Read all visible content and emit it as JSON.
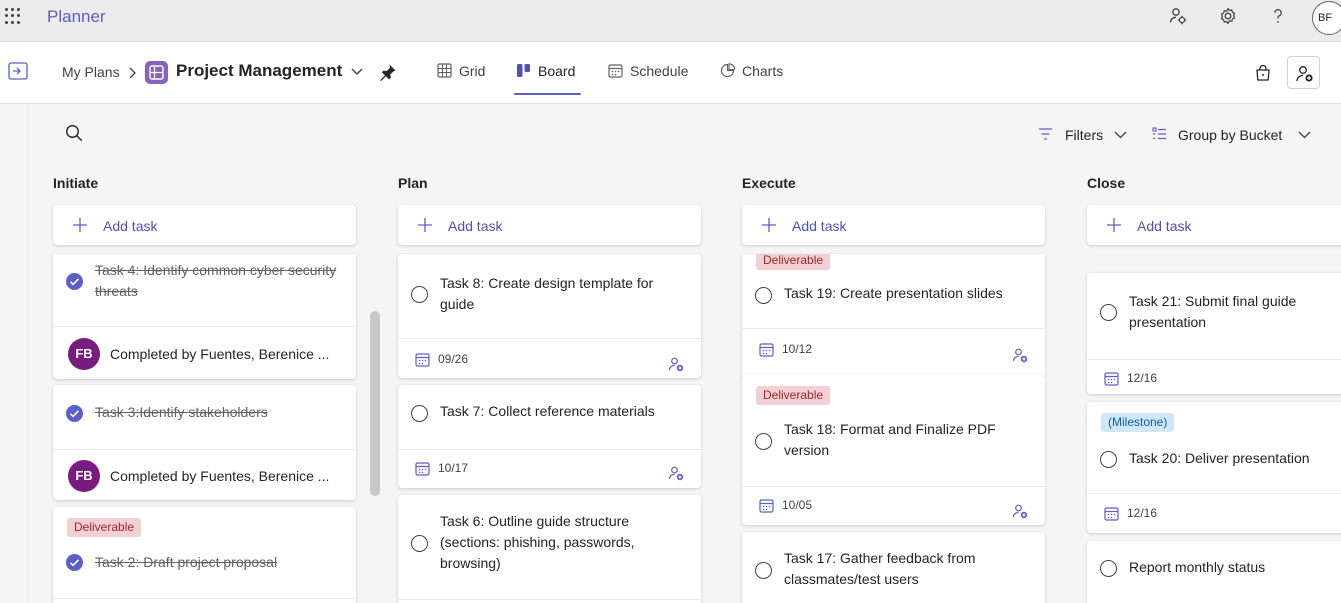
{
  "app": {
    "name": "Planner",
    "user_initials": "BF"
  },
  "header": {
    "breadcrumb_root": "My Plans",
    "plan_title": "Project Management",
    "tabs": [
      {
        "label": "Grid",
        "icon": "grid-icon",
        "active": false
      },
      {
        "label": "Board",
        "icon": "board-icon",
        "active": true
      },
      {
        "label": "Schedule",
        "icon": "calendar-icon",
        "active": false
      },
      {
        "label": "Charts",
        "icon": "chart-icon",
        "active": false
      }
    ]
  },
  "toolbar": {
    "filters_label": "Filters",
    "group_by_label": "Group by Bucket"
  },
  "colors": {
    "accent": "#5b5fc7",
    "deliverable_bg": "#f1d0d3",
    "milestone_bg": "#d0e7f8",
    "avatar": "#7a1c7f"
  },
  "buckets": [
    {
      "name": "Initiate",
      "add_task_label": "Add task",
      "tasks": [
        {
          "title": "Task 4: Identify common cyber security threats",
          "completed": true,
          "avatar": "FB",
          "completed_by": "Completed by Fuentes, Berenice ..."
        },
        {
          "title": "Task 3:Identify stakeholders",
          "completed": true,
          "avatar": "FB",
          "completed_by": "Completed by Fuentes, Berenice ..."
        },
        {
          "label": "Deliverable",
          "title": "Task 2: Draft project proposal",
          "completed": true
        }
      ]
    },
    {
      "name": "Plan",
      "add_task_label": "Add task",
      "tasks": [
        {
          "title": "Task 8: Create design template for guide",
          "completed": false,
          "due": "09/26"
        },
        {
          "title": "Task 7: Collect reference materials",
          "completed": false,
          "due": "10/17"
        },
        {
          "title": "Task 6: Outline guide structure (sections: phishing, passwords, browsing)",
          "completed": false
        }
      ]
    },
    {
      "name": "Execute",
      "add_task_label": "Add task",
      "tasks": [
        {
          "label": "Deliverable",
          "title": "Task 19: Create presentation slides",
          "completed": false,
          "due": "10/12"
        },
        {
          "label": "Deliverable",
          "title": "Task 18: Format and Finalize PDF version",
          "completed": false,
          "due": "10/05"
        },
        {
          "title": "Task 17: Gather feedback from classmates/test users",
          "completed": false
        }
      ]
    },
    {
      "name": "Close",
      "add_task_label": "Add task",
      "tasks": [
        {
          "title": "Task 21: Submit final guide presentation",
          "completed": false,
          "due": "12/16"
        },
        {
          "label": "(Milestone)",
          "title": "Task 20: Deliver presentation",
          "completed": false,
          "due": "12/16"
        },
        {
          "title": "Report monthly status",
          "completed": false
        }
      ]
    }
  ]
}
